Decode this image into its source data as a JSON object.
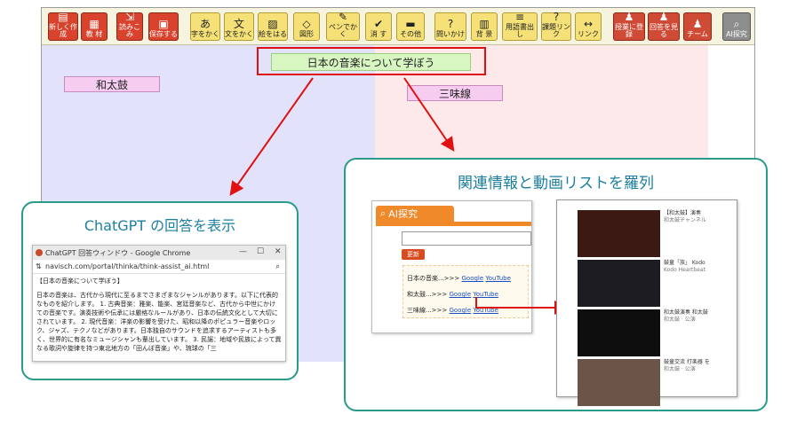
{
  "toolbar": {
    "buttons": [
      {
        "label": "新しく作成",
        "icon": "new-doc-icon",
        "glyph": "▤"
      },
      {
        "label": "教 材",
        "icon": "material-icon",
        "glyph": "▦"
      },
      {
        "label": "読みこみ",
        "icon": "import-icon",
        "glyph": "⇲"
      },
      {
        "label": "保存する",
        "icon": "save-icon",
        "glyph": "▣"
      },
      {
        "label": "字をかく",
        "icon": "char-icon",
        "glyph": "あ"
      },
      {
        "label": "文をかく",
        "icon": "text-icon",
        "glyph": "文"
      },
      {
        "label": "絵をはる",
        "icon": "picture-icon",
        "glyph": "▨"
      },
      {
        "label": "図形",
        "icon": "shape-icon",
        "glyph": "◇"
      },
      {
        "label": "ペンでかく",
        "icon": "pen-icon",
        "glyph": "✎"
      },
      {
        "label": "消 す",
        "icon": "erase-icon",
        "glyph": "✔"
      },
      {
        "label": "その他",
        "icon": "other-icon",
        "glyph": "▬"
      },
      {
        "label": "問いかけ",
        "icon": "question-icon",
        "glyph": "?"
      },
      {
        "label": "背 景",
        "icon": "background-icon",
        "glyph": "▥"
      },
      {
        "label": "用語書出し",
        "icon": "terms-icon",
        "glyph": "≡"
      },
      {
        "label": "課題リンク",
        "icon": "task-link-icon",
        "glyph": "?"
      },
      {
        "label": "リンク",
        "icon": "link-icon",
        "glyph": "↔"
      },
      {
        "label": "授業に登録",
        "icon": "register-icon",
        "glyph": "♟"
      },
      {
        "label": "回答を見る",
        "icon": "answers-icon",
        "glyph": "♟"
      },
      {
        "label": "チーム",
        "icon": "team-icon",
        "glyph": "♟"
      },
      {
        "label": "AI探究",
        "icon": "ai-search-icon",
        "glyph": "⌕"
      }
    ]
  },
  "canvas": {
    "title_card": "日本の音楽について学ぼう",
    "card_wadaiko": "和太鼓",
    "card_shamisen": "三味線"
  },
  "callout_chatgpt": {
    "heading": "ChatGPT の回答を表示",
    "window_title": "ChatGPT 回答ウィンドウ - Google Chrome",
    "url": "navisch.com/portal/thinka/think-assist_ai.html",
    "body_title": "【日本の音楽について学ぼう】",
    "body_text": "日本の音楽は、古代から現代に至るまでさまざまなジャンルがあります。以下に代表的なものを紹介します。 1. 古典音楽：雅楽、能楽、宮廷音楽など、古代から中世にかけての音楽です。演奏技術や伝承には厳格なルールがあり、日本の伝統文化として大切にされています。 2. 現代音楽：洋楽の影響を受けた、昭和以降のポピュラー音楽やロック、ジャズ、テクノなどがあります。日本独自のサウンドを追求するアーティストも多く、世界的に有名なミュージシャンも輩出しています。 3. 民謡：地域や民族によって異なる歌詞や旋律を持つ東北地方の「田んぼ音楽」や、琉球の「三"
  },
  "callout_related": {
    "heading": "関連情報と動画リストを羅列",
    "ai_title": "AI探究",
    "update_button": "更新",
    "rows": [
      {
        "label": "日本の音楽...>>> ",
        "google": "Google",
        "youtube": "YouTube"
      },
      {
        "label": "和太鼓...>>> ",
        "google": "Google",
        "youtube": "YouTube"
      },
      {
        "label": "三味線...>>> ",
        "google": "Google",
        "youtube": "YouTube"
      }
    ],
    "videos": [
      {
        "title": "【和太鼓】演奏",
        "meta": "和太鼓チャンネル"
      },
      {
        "title": "鼓童「族」 Kodo",
        "meta": "Kodo Heartbeat"
      },
      {
        "title": "和太鼓演奏 和太鼓",
        "meta": "和太鼓 · 公演"
      },
      {
        "title": "鼓童交流 打楽器 を",
        "meta": "和太鼓 · 公演"
      }
    ]
  },
  "colors": {
    "toolbar_red": "#d9432d",
    "toolbar_yellow": "#f5e178",
    "callout_border": "#2a9a8a",
    "arrow_red": "#e01111"
  }
}
